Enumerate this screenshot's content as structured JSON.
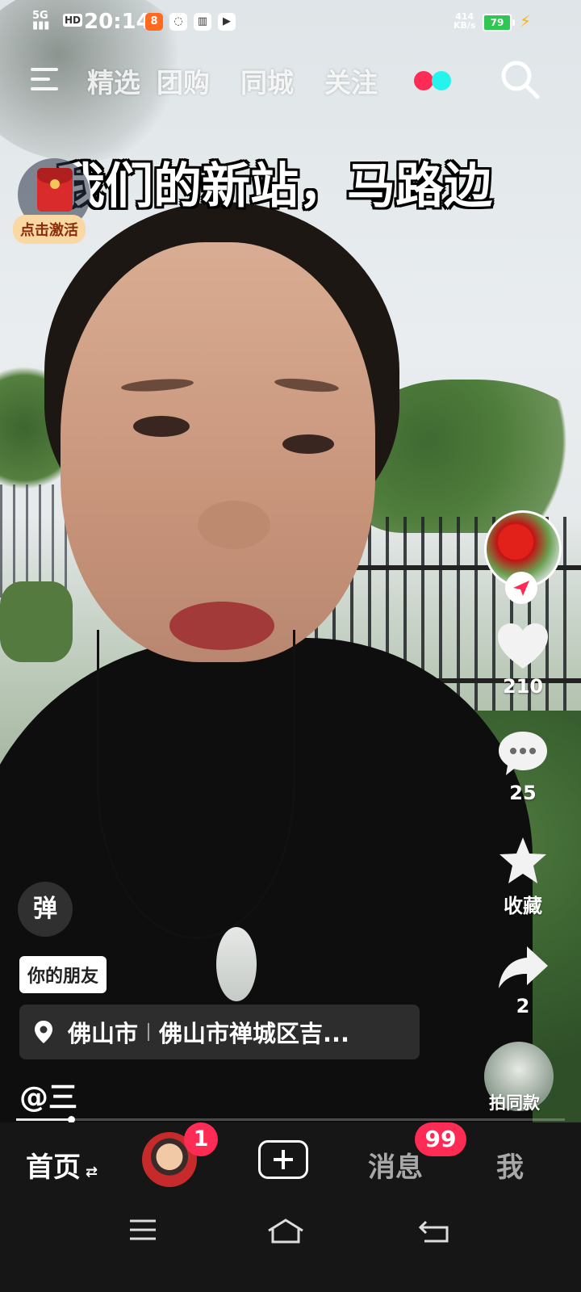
{
  "status_bar": {
    "network": "5G",
    "hd_label": "HD",
    "time": "20:14",
    "speed_value": "414",
    "speed_unit": "KB/s",
    "battery": "79"
  },
  "top_nav": {
    "tabs": [
      "精选",
      "团购",
      "同城",
      "关注"
    ]
  },
  "caption": "我们的新站，马路边",
  "red_packet": {
    "label": "点击激活"
  },
  "right_rail": {
    "likes": "210",
    "comments": "25",
    "favorite_label": "收藏",
    "shares": "2",
    "same_style_label": "拍同款"
  },
  "danmu_label": "弹",
  "friend_tag": "你的朋友",
  "location": {
    "city": "佛山市",
    "address": "佛山市禅城区吉..."
  },
  "author": "@三",
  "progress": 0.1,
  "bottom_nav": {
    "home_label": "首页",
    "home_badge": "1",
    "messages_label": "消息",
    "messages_badge": "99",
    "me_label": "我"
  },
  "colors": {
    "like_red": "#fe2c55",
    "accent_cyan": "#25f4ee",
    "nav_bg": "#161616"
  }
}
